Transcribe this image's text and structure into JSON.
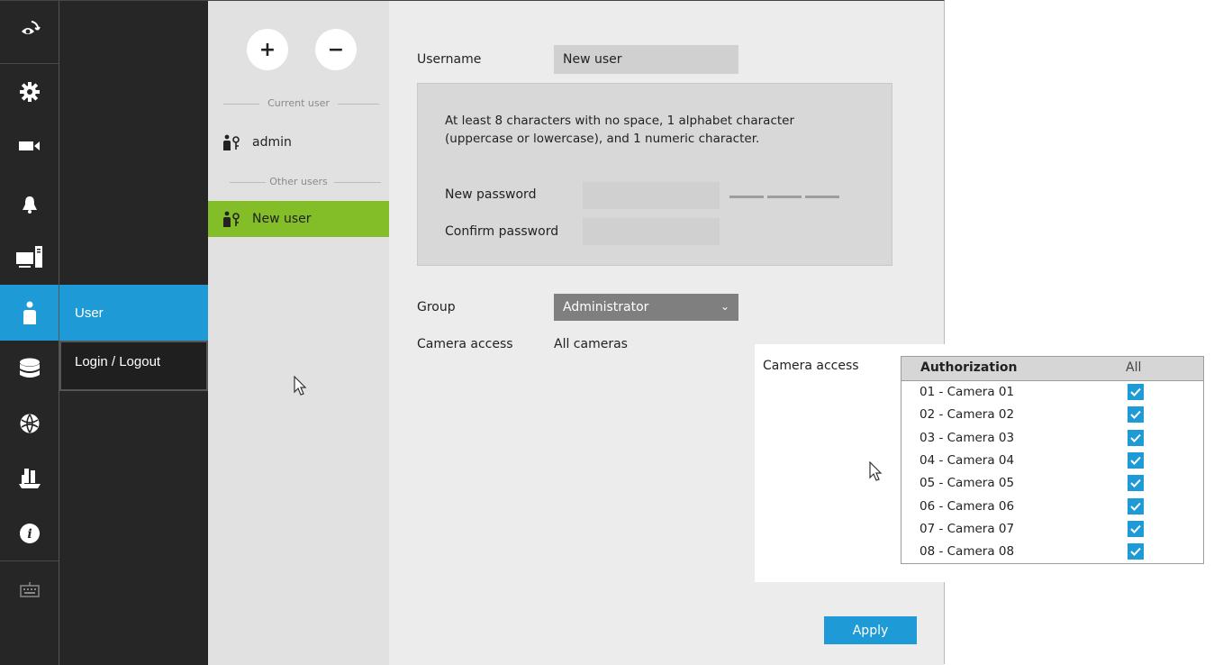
{
  "rail": {
    "items": [
      {
        "icon": "eye-refresh-icon"
      },
      {
        "icon": "gear-icon"
      },
      {
        "icon": "video-camera-icon"
      },
      {
        "icon": "bell-icon"
      },
      {
        "icon": "monitor-tower-icon"
      },
      {
        "icon": "user-icon",
        "active": true
      },
      {
        "icon": "database-icon"
      },
      {
        "icon": "globe-network-icon"
      },
      {
        "icon": "tools-icon"
      },
      {
        "icon": "info-icon"
      },
      {
        "icon": "keyboard-icon"
      }
    ]
  },
  "submenu": {
    "items": [
      {
        "label": "User"
      },
      {
        "label": "Login / Logout"
      }
    ]
  },
  "userlist": {
    "add_label": "+",
    "remove_label": "−",
    "current_header": "Current user",
    "other_header": "Other users",
    "current_users": [
      {
        "name": "admin"
      }
    ],
    "other_users": [
      {
        "name": "New user"
      }
    ]
  },
  "form": {
    "username_label": "Username",
    "username_value": "New user",
    "password_hint": "At least 8 characters with no space, 1 alphabet character (uppercase or lowercase), and 1 numeric character.",
    "new_password_label": "New password",
    "confirm_password_label": "Confirm password",
    "group_label": "Group",
    "group_value": "Administrator",
    "camera_access_label": "Camera access",
    "camera_access_value": "All cameras",
    "apply_label": "Apply"
  },
  "camera_popup": {
    "label": "Camera access",
    "col_authorization": "Authorization",
    "col_all": "All",
    "cameras": [
      {
        "name": "01 - Camera 01",
        "checked": true
      },
      {
        "name": "02 - Camera 02",
        "checked": true
      },
      {
        "name": "03 - Camera 03",
        "checked": true
      },
      {
        "name": "04 - Camera 04",
        "checked": true
      },
      {
        "name": "05 - Camera 05",
        "checked": true
      },
      {
        "name": "06 - Camera 06",
        "checked": true
      },
      {
        "name": "07 - Camera 07",
        "checked": true
      },
      {
        "name": "08 - Camera 08",
        "checked": true
      }
    ]
  },
  "colors": {
    "accent": "#1e9ad6",
    "selected_user": "#83bd27",
    "rail_bg": "#262626"
  }
}
